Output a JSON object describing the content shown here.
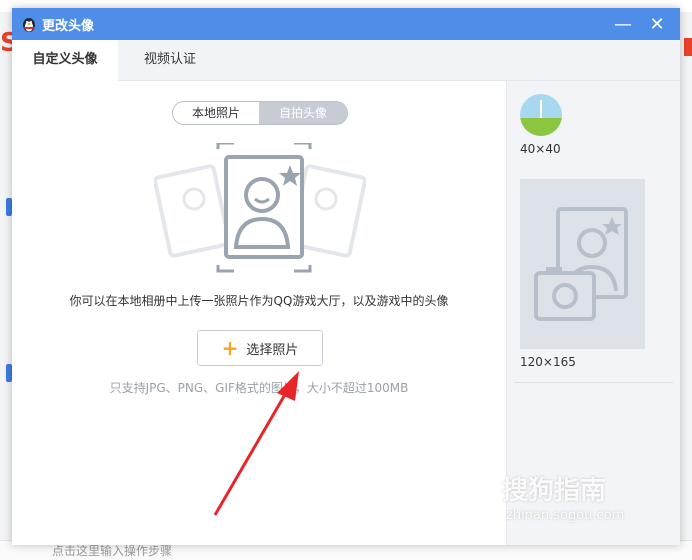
{
  "dialog": {
    "title": "更改头像",
    "minimize_symbol": "—",
    "close_symbol": "✕"
  },
  "tabs": [
    {
      "label": "自定义头像",
      "active": true
    },
    {
      "label": "视频认证",
      "active": false
    }
  ],
  "source_toggle": {
    "options": [
      "本地照片",
      "自拍头像"
    ],
    "selected": "本地照片"
  },
  "upload": {
    "description": "你可以在本地相册中上传一张照片作为QQ游戏大厅，以及游戏中的头像",
    "button_icon": "plus-icon",
    "button_label": "选择照片",
    "hint": "只支持JPG、PNG、GIF格式的图片，大小不超过100MB"
  },
  "preview": {
    "small_size": "40×40",
    "large_size": "120×165"
  },
  "background": {
    "bottom_text": "点击这里输入操作步骤"
  },
  "watermark": {
    "brand": "搜狗指南",
    "url": "zhinan.sogou.com"
  },
  "colors": {
    "titlebar": "#4f8ee8",
    "accent_plus": "#f4a623",
    "arrow": "#e8262a"
  }
}
